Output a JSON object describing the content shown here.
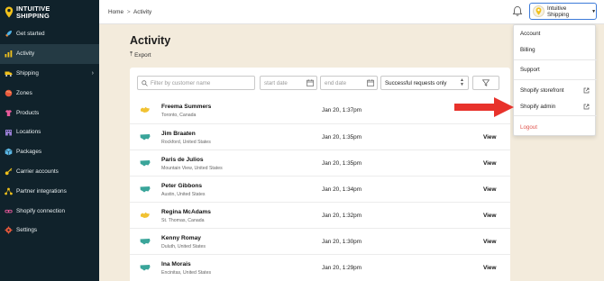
{
  "brand": {
    "line1": "INTUITIVE",
    "line2": "SHIPPING"
  },
  "sidebar": {
    "items": [
      {
        "label": "Get started",
        "icon": "rocket-icon"
      },
      {
        "label": "Activity",
        "icon": "activity-icon",
        "active": true
      },
      {
        "label": "Shipping",
        "icon": "truck-icon",
        "has_submenu": true
      },
      {
        "label": "Zones",
        "icon": "globe-icon"
      },
      {
        "label": "Products",
        "icon": "shirt-icon"
      },
      {
        "label": "Locations",
        "icon": "building-icon"
      },
      {
        "label": "Packages",
        "icon": "box-icon"
      },
      {
        "label": "Carrier accounts",
        "icon": "key-icon"
      },
      {
        "label": "Partner integrations",
        "icon": "network-icon"
      },
      {
        "label": "Shopify connection",
        "icon": "link-icon"
      },
      {
        "label": "Settings",
        "icon": "gear-icon"
      }
    ]
  },
  "topbar": {
    "breadcrumb_home": "Home",
    "breadcrumb_sep": ">",
    "breadcrumb_current": "Activity",
    "store_button_label": "Intuitive Shipping"
  },
  "main": {
    "title": "Activity",
    "export_label": "Export"
  },
  "filters": {
    "search_placeholder": "Filter by customer name",
    "start_placeholder": "start date",
    "end_placeholder": "end date",
    "select_value": "Successful requests only"
  },
  "rows": [
    {
      "name": "Freema Summers",
      "location": "Toronto, Canada",
      "date": "Jan 20, 1:37pm",
      "flag": "canada",
      "view": ""
    },
    {
      "name": "Jim Braaten",
      "location": "Rockford, United States",
      "date": "Jan 20, 1:35pm",
      "flag": "usa",
      "view": "View"
    },
    {
      "name": "Paris de Julios",
      "location": "Mountain View, United States",
      "date": "Jan 20, 1:35pm",
      "flag": "usa",
      "view": "View"
    },
    {
      "name": "Peter Gibbons",
      "location": "Austin, United States",
      "date": "Jan 20, 1:34pm",
      "flag": "usa",
      "view": "View"
    },
    {
      "name": "Regina McAdams",
      "location": "St. Thomas, Canada",
      "date": "Jan 20, 1:32pm",
      "flag": "canada",
      "view": "View"
    },
    {
      "name": "Kenny Romay",
      "location": "Duluth, United States",
      "date": "Jan 20, 1:30pm",
      "flag": "usa",
      "view": "View"
    },
    {
      "name": "Ina Morais",
      "location": "Encinitas, United States",
      "date": "Jan 20, 1:29pm",
      "flag": "usa",
      "view": "View"
    }
  ],
  "menu": {
    "account": "Account",
    "billing": "Billing",
    "support": "Support",
    "storefront": "Shopify storefront",
    "admin": "Shopify admin",
    "logout": "Logout"
  },
  "colors": {
    "sidebar_bg": "#10222b",
    "page_bg": "#f3ebdc",
    "accent_blue": "#3d7bd9",
    "arrow_red": "#e8322b",
    "logout_red": "#e0554f",
    "brand_yellow": "#f2c21b",
    "usa_teal": "#3aa59a",
    "canada_yellow": "#f1c232"
  }
}
